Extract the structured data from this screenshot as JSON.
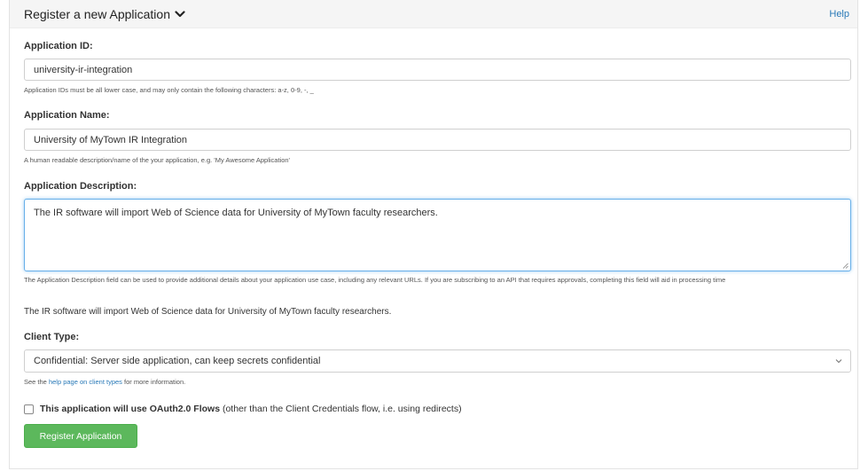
{
  "header": {
    "title": "Register a new Application",
    "chevron_icon": "chevron-down-icon",
    "help_label": "Help"
  },
  "form": {
    "app_id": {
      "label": "Application ID:",
      "value": "university-ir-integration",
      "hint": "Application IDs must be all lower case, and may only contain the following characters: a-z, 0-9, -, _"
    },
    "app_name": {
      "label": "Application Name:",
      "value": "University of MyTown IR Integration",
      "hint": "A human readable description/name of the your application, e.g. 'My Awesome Application'"
    },
    "app_description": {
      "label": "Application Description:",
      "value": "The IR software will import Web of Science data for University of MyTown faculty researchers.",
      "hint": "The Application Description field can be used to provide additional details about your application use case, including any relevant URLs. If you are subscribing to an API that requires approvals, completing this field will aid in processing time",
      "echo": "The IR software will import Web of Science data for University of MyTown faculty researchers."
    },
    "client_type": {
      "label": "Client Type:",
      "selected": "Confidential: Server side application, can keep secrets confidential",
      "hint_prefix": "See the ",
      "hint_link": "help page on client types",
      "hint_suffix": " for more information."
    },
    "oauth": {
      "label_bold": "This application will use OAuth2.0 Flows",
      "label_rest": " (other than the Client Credentials flow, i.e. using redirects)",
      "checked": false
    },
    "submit_label": "Register Application"
  },
  "colors": {
    "accent_link": "#2a7ab8",
    "button_green": "#5cb85c",
    "focus_border": "#66afe9"
  }
}
